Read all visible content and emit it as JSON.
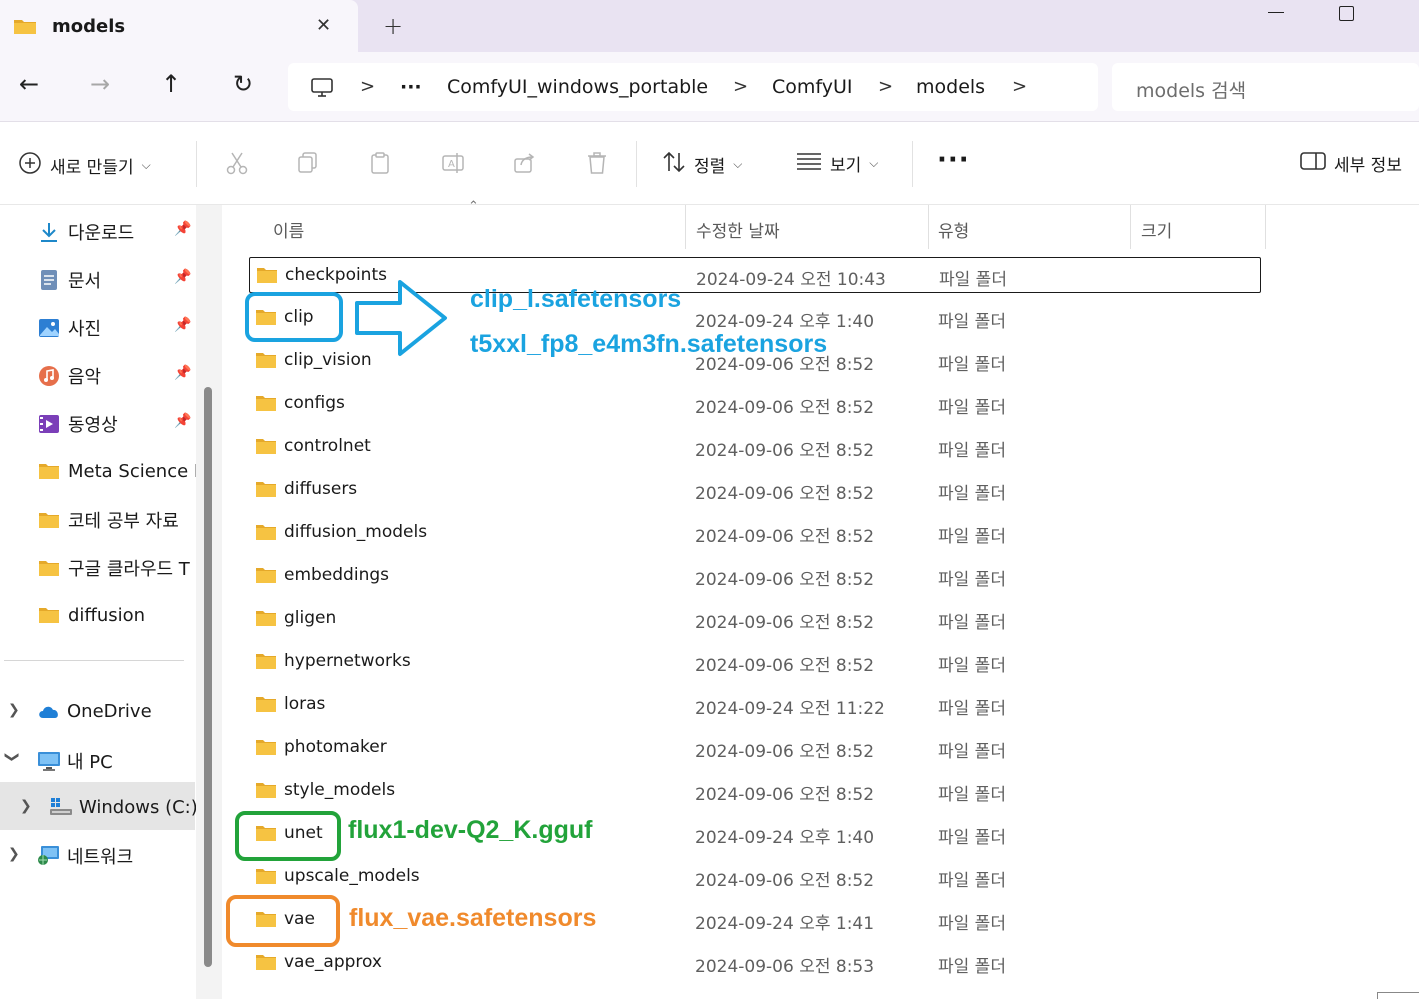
{
  "window": {
    "tab_title": "models",
    "tab_close": "✕",
    "new_tab": "+"
  },
  "address": {
    "back": "←",
    "forward": "→",
    "up": "↑",
    "refresh": "↻",
    "overflow": "···",
    "separator": ">",
    "crumbs": [
      "ComfyUI_windows_portable",
      "ComfyUI",
      "models"
    ],
    "search_placeholder": "models 검색"
  },
  "toolbar": {
    "new_label": "새로 만들기",
    "sort_label": "정렬",
    "view_label": "보기",
    "more_label": "···",
    "details_label": "세부 정보"
  },
  "sidebar": {
    "quick_access": [
      {
        "label": "다운로드",
        "icon": "download-icon",
        "pinned": true
      },
      {
        "label": "문서",
        "icon": "documents-icon",
        "pinned": true
      },
      {
        "label": "사진",
        "icon": "pictures-icon",
        "pinned": true
      },
      {
        "label": "음악",
        "icon": "music-icon",
        "pinned": true
      },
      {
        "label": "동영상",
        "icon": "videos-icon",
        "pinned": true
      },
      {
        "label": "Meta Science M",
        "icon": "folder-icon",
        "pinned": false
      },
      {
        "label": "코테 공부 자료",
        "icon": "folder-icon",
        "pinned": false
      },
      {
        "label": "구글 클라우드 T",
        "icon": "folder-icon",
        "pinned": false
      },
      {
        "label": "diffusion",
        "icon": "folder-icon",
        "pinned": false
      }
    ],
    "tree": {
      "onedrive": "OneDrive",
      "this_pc": "내 PC",
      "windows_c": "Windows (C:)",
      "network": "네트워크"
    }
  },
  "columns": {
    "name": "이름",
    "modified": "수정한 날짜",
    "type": "유형",
    "size": "크기"
  },
  "files": [
    {
      "name": "checkpoints",
      "modified": "2024-09-24 오전 10:43",
      "type": "파일 폴더"
    },
    {
      "name": "clip",
      "modified": "2024-09-24 오후 1:40",
      "type": "파일 폴더"
    },
    {
      "name": "clip_vision",
      "modified": "2024-09-06 오전 8:52",
      "type": "파일 폴더"
    },
    {
      "name": "configs",
      "modified": "2024-09-06 오전 8:52",
      "type": "파일 폴더"
    },
    {
      "name": "controlnet",
      "modified": "2024-09-06 오전 8:52",
      "type": "파일 폴더"
    },
    {
      "name": "diffusers",
      "modified": "2024-09-06 오전 8:52",
      "type": "파일 폴더"
    },
    {
      "name": "diffusion_models",
      "modified": "2024-09-06 오전 8:52",
      "type": "파일 폴더"
    },
    {
      "name": "embeddings",
      "modified": "2024-09-06 오전 8:52",
      "type": "파일 폴더"
    },
    {
      "name": "gligen",
      "modified": "2024-09-06 오전 8:52",
      "type": "파일 폴더"
    },
    {
      "name": "hypernetworks",
      "modified": "2024-09-06 오전 8:52",
      "type": "파일 폴더"
    },
    {
      "name": "loras",
      "modified": "2024-09-24 오전 11:22",
      "type": "파일 폴더"
    },
    {
      "name": "photomaker",
      "modified": "2024-09-06 오전 8:52",
      "type": "파일 폴더"
    },
    {
      "name": "style_models",
      "modified": "2024-09-06 오전 8:52",
      "type": "파일 폴더"
    },
    {
      "name": "unet",
      "modified": "2024-09-24 오후 1:40",
      "type": "파일 폴더"
    },
    {
      "name": "upscale_models",
      "modified": "2024-09-06 오전 8:52",
      "type": "파일 폴더"
    },
    {
      "name": "vae",
      "modified": "2024-09-24 오후 1:41",
      "type": "파일 폴더"
    },
    {
      "name": "vae_approx",
      "modified": "2024-09-06 오전 8:53",
      "type": "파일 폴더"
    }
  ],
  "annotations": {
    "clip_line1": "clip_l.safetensors",
    "clip_line2": "t5xxl_fp8_e4m3fn.safetensors",
    "unet": "flux1-dev-Q2_K.gguf",
    "vae": "flux_vae.safetensors",
    "colors": {
      "blue": "#1aa3e0",
      "green": "#22a33a",
      "orange": "#f08a2c"
    }
  },
  "colors": {
    "folder_yellow": "#f6c342",
    "folder_yellow_dark": "#e5a92a",
    "titlebar": "#e9e3f2"
  }
}
